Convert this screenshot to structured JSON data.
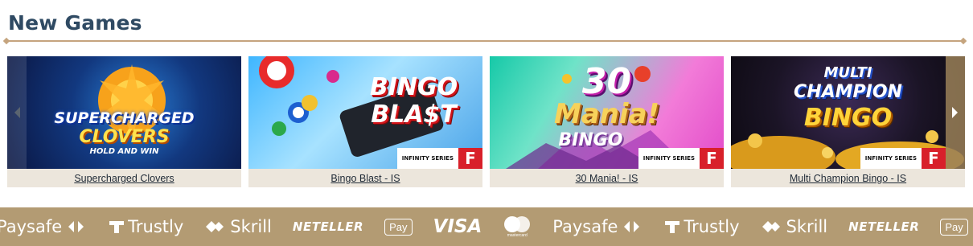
{
  "section": {
    "title": "New Games"
  },
  "games": [
    {
      "title": "Supercharged Clovers",
      "art_line1": "SUPERCHARGED",
      "art_line2": "CLOVERS",
      "art_line3": "HOLD AND WIN"
    },
    {
      "title": "Bingo Blast - IS",
      "art_line1": "BINGO",
      "art_line2": "BLA$T",
      "badge_series": "INFINITY SERIES",
      "badge_letter": "F"
    },
    {
      "title": "30 Mania! - IS",
      "art_line1": "30",
      "art_line2": "Mania!",
      "art_line3": "BINGO",
      "badge_series": "INFINITY SERIES",
      "badge_letter": "F"
    },
    {
      "title": "Multi Champion Bingo - IS",
      "art_line1": "MULTI",
      "art_line2": "CHAMPION",
      "art_line3": "BINGO",
      "badge_series": "INFINITY SERIES",
      "badge_letter": "F"
    }
  ],
  "payments": {
    "paysafe": "Paysafe",
    "trustly": "Trustly",
    "skrill": "Skrill",
    "neteller": "NETELLER",
    "applepay": "Pay",
    "visa": "VISA",
    "mastercard": "mastercard",
    "visa_partial": "VI"
  },
  "colors": {
    "heading": "#2f4a63",
    "accent": "#c5a47e",
    "payband": "#b39b73",
    "caption_bg": "#ece6dc"
  }
}
